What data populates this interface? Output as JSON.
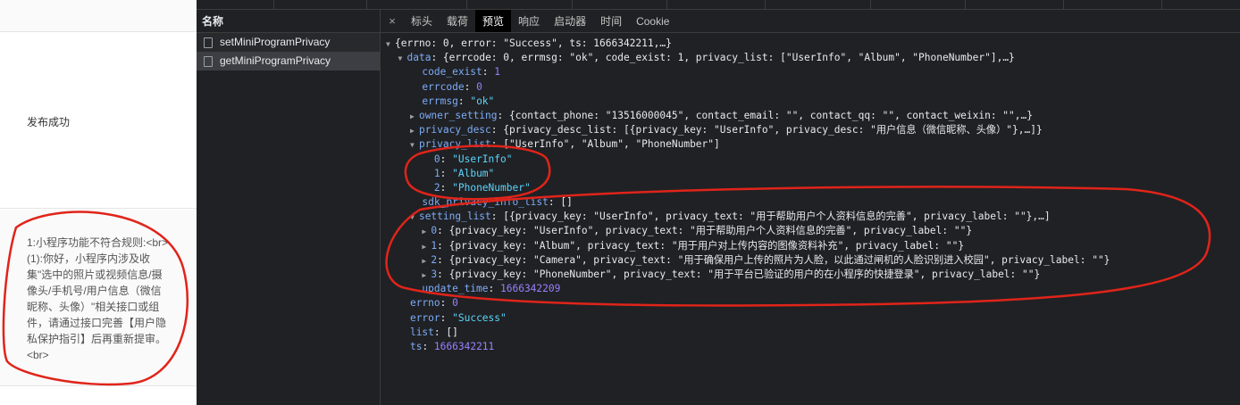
{
  "left_page": {
    "status": "发布成功",
    "reason": "1:小程序功能不符合规则:<br>(1):你好，小程序内涉及收集\"选中的照片或视频信息/摄像头/手机号/用户信息（微信昵称、头像）\"相关接口或组件，请通过接口完善【用户隐私保护指引】后再重新提审。<br>"
  },
  "request_list": {
    "header": "名称",
    "items": [
      {
        "name": "setMiniProgramPrivacy"
      },
      {
        "name": "getMiniProgramPrivacy"
      }
    ]
  },
  "tabs": {
    "close": "×",
    "items": [
      "标头",
      "载荷",
      "预览",
      "响应",
      "启动器",
      "时间",
      "Cookie"
    ],
    "active": "预览"
  },
  "preview": {
    "root_summary": "{errno: 0, error: \"Success\", ts: 1666342211,…}",
    "data_key": "data",
    "data_summary": "{errcode: 0, errmsg: \"ok\", code_exist: 1, privacy_list: [\"UserInfo\", \"Album\", \"PhoneNumber\"],…}",
    "code_exist_key": "code_exist",
    "code_exist": "1",
    "errcode_key": "errcode",
    "errcode": "0",
    "errmsg_key": "errmsg",
    "errmsg": "\"ok\"",
    "owner_setting_key": "owner_setting",
    "owner_setting_summary": "{contact_phone: \"13516000045\", contact_email: \"\", contact_qq: \"\", contact_weixin: \"\",…}",
    "privacy_desc_key": "privacy_desc",
    "privacy_desc_summary": "{privacy_desc_list: [{privacy_key: \"UserInfo\", privacy_desc: \"用户信息（微信昵称、头像）\"},…]}",
    "privacy_list_key": "privacy_list",
    "privacy_list_summary": "[\"UserInfo\", \"Album\", \"PhoneNumber\"]",
    "privacy_list": [
      {
        "idx": "0",
        "val": "\"UserInfo\""
      },
      {
        "idx": "1",
        "val": "\"Album\""
      },
      {
        "idx": "2",
        "val": "\"PhoneNumber\""
      }
    ],
    "sdk_key": "sdk_privacy_info_list",
    "sdk_val": "[]",
    "setting_list_key": "setting_list",
    "setting_list_summary": "[{privacy_key: \"UserInfo\", privacy_text: \"用于帮助用户个人资料信息的完善\", privacy_label: \"\"},…]",
    "setting_list": [
      {
        "idx": "0",
        "summary": "{privacy_key: \"UserInfo\", privacy_text: \"用于帮助用户个人资料信息的完善\", privacy_label: \"\"}"
      },
      {
        "idx": "1",
        "summary": "{privacy_key: \"Album\", privacy_text: \"用于用户对上传内容的图像资料补充\", privacy_label: \"\"}"
      },
      {
        "idx": "2",
        "summary": "{privacy_key: \"Camera\", privacy_text: \"用于确保用户上传的照片为人脸，以此通过闸机的人脸识别进入校园\", privacy_label: \"\"}"
      },
      {
        "idx": "3",
        "summary": "{privacy_key: \"PhoneNumber\", privacy_text: \"用于平台已验证的用户的在小程序的快捷登录\", privacy_label: \"\"}"
      }
    ],
    "update_time_key": "update_time",
    "update_time": "1666342209",
    "errno_key": "errno",
    "errno": "0",
    "error_key": "error",
    "error": "\"Success\"",
    "list_key": "list",
    "list": "[]",
    "ts_key": "ts",
    "ts": "1666342211"
  },
  "colors": {
    "annotation": "#e0241a",
    "key": "#7cacf8",
    "string": "#5cd5fb",
    "number": "#9980ff"
  }
}
